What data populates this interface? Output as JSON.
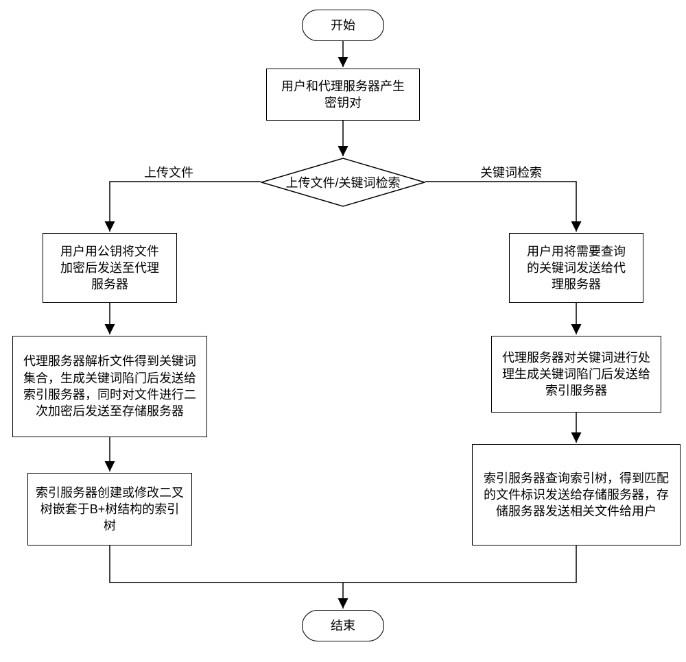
{
  "nodes": {
    "start": "开始",
    "genKeys": "用户和代理服务器产生\n密钥对",
    "decision": "上传文件/关键词检索",
    "leftEdge": "上传文件",
    "rightEdge": "关键词检索",
    "l1": "用户用公钥将文件\n加密后发送至代理\n服务器",
    "l2": "代理服务器解析文件得到关键词集合，生成关键词陷门后发送给索引服务器，同时对文件进行二次加密后发送至存储服务器",
    "l3": "索引服务器创建或修改二叉树嵌套于B+树结构的索引树",
    "r1": "用户用将需要查询\n的关键词发送给代\n理服务器",
    "r2": "代理服务器对关键词进行处理生成关键词陷门后发送给索引服务器",
    "r3": "索引服务器查询索引树，得到匹配的文件标识发送给存储服务器，存储服务器发送相关文件给用户",
    "end": "结束"
  }
}
